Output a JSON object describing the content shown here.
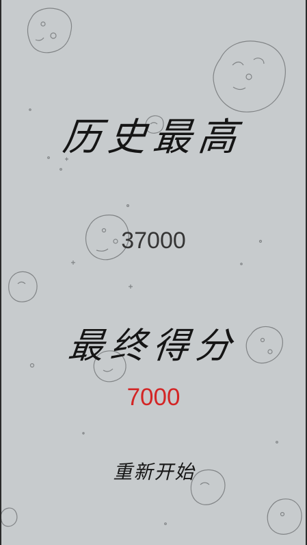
{
  "texts": {
    "best_title": "历史最高",
    "best_score": "37000",
    "final_title": "最终得分",
    "final_score": "7000",
    "restart": "重新开始"
  },
  "colors": {
    "background": "#c7cbcd",
    "title": "#151515",
    "best_score": "#353535",
    "final_score": "#d32525"
  },
  "decor": [
    {
      "name": "asteroid-icon-1"
    },
    {
      "name": "asteroid-icon-2"
    },
    {
      "name": "asteroid-icon-3"
    },
    {
      "name": "asteroid-icon-4"
    },
    {
      "name": "asteroid-icon-5"
    },
    {
      "name": "asteroid-icon-6"
    },
    {
      "name": "asteroid-icon-7"
    },
    {
      "name": "asteroid-icon-8"
    },
    {
      "name": "asteroid-icon-9"
    },
    {
      "name": "asteroid-icon-10"
    }
  ]
}
